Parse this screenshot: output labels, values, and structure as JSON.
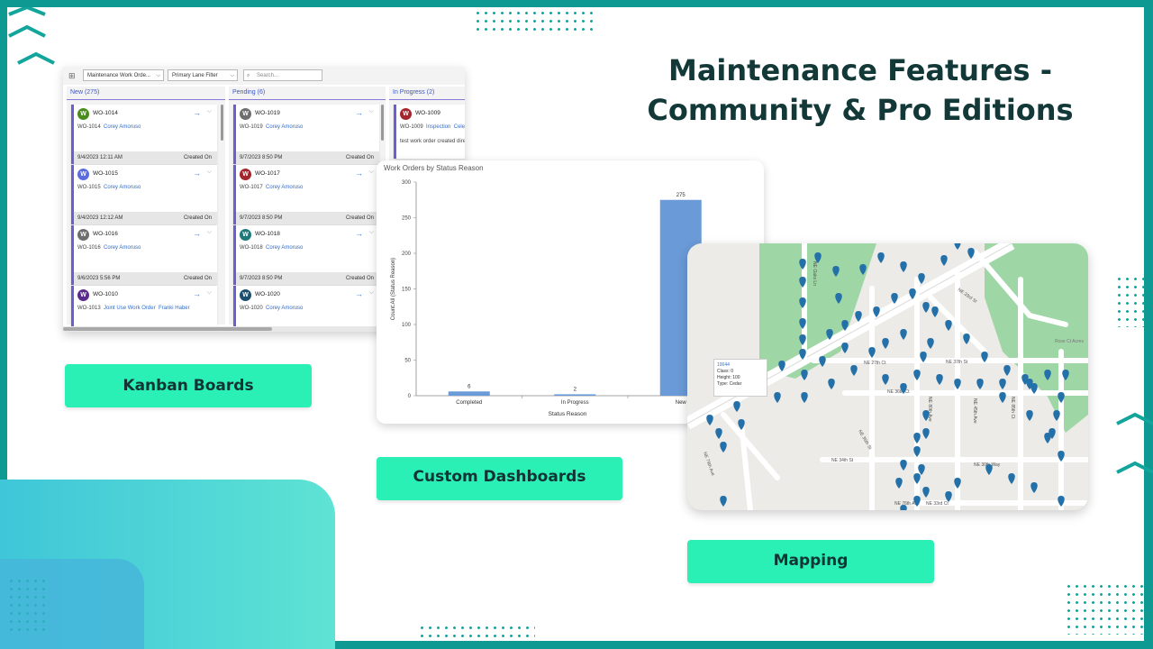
{
  "title": "Maintenance Features - Community & Pro Editions",
  "labels": {
    "kanban": "Kanban Boards",
    "dashboards": "Custom Dashboards",
    "mapping": "Mapping"
  },
  "colors": {
    "frame": "#0e9a93",
    "label_bg": "#2af0b6",
    "bar": "#6a9bd8",
    "park": "#9fd6a6",
    "pin": "#2470a8"
  },
  "kanban": {
    "toolbar": {
      "view_select": "Maintenance Work Orde...",
      "lane_filter": "Primary Lane Filter",
      "search_placeholder": "Search..."
    },
    "columns": [
      {
        "header": "New (275)",
        "cards": [
          {
            "avatar": "W",
            "avatar_color": "#4a8c1c",
            "title": "WO-1014",
            "sub": "WO-1014",
            "person": "Corey Amoruso",
            "date": "9/4/2023 12:11 AM",
            "foot": "Created On"
          },
          {
            "avatar": "W",
            "avatar_color": "#5b6be0",
            "title": "WO-1015",
            "sub": "WO-1015",
            "person": "Corey Amoruso",
            "date": "9/4/2023 12:12 AM",
            "foot": "Created On"
          },
          {
            "avatar": "W",
            "avatar_color": "#6e6e6e",
            "title": "WO-1016",
            "sub": "WO-1016",
            "person": "Corey Amoruso",
            "date": "9/6/2023 5:56 PM",
            "foot": "Created On"
          },
          {
            "avatar": "W",
            "avatar_color": "#5a2a8c",
            "title": "WO-1010",
            "sub": "WO-1013",
            "person": "Joint Use Work Order",
            "person2": "Franki Haber",
            "date": "",
            "foot": ""
          }
        ]
      },
      {
        "header": "Pending (6)",
        "cards": [
          {
            "avatar": "W",
            "avatar_color": "#6e6e6e",
            "title": "WO-1019",
            "sub": "WO-1019",
            "person": "Corey Amoruso",
            "date": "9/7/2023 8:50 PM",
            "foot": "Created On"
          },
          {
            "avatar": "W",
            "avatar_color": "#a4262c",
            "title": "WO-1017",
            "sub": "WO-1017",
            "person": "Corey Amoruso",
            "date": "9/7/2023 8:50 PM",
            "foot": "Created On"
          },
          {
            "avatar": "W",
            "avatar_color": "#1e7a7a",
            "title": "WO-1018",
            "sub": "WO-1018",
            "person": "Corey Amoruso",
            "date": "9/7/2023 8:50 PM",
            "foot": "Created On"
          },
          {
            "avatar": "W",
            "avatar_color": "#1b4f6e",
            "title": "WO-1020",
            "sub": "WO-1020",
            "person": "Corey Amoruso",
            "date": "",
            "foot": ""
          }
        ]
      },
      {
        "header": "In Progress (2)",
        "cards": [
          {
            "avatar": "W",
            "avatar_color": "#a4262c",
            "title": "WO-1009",
            "sub": "WO-1009",
            "person": "Inspection",
            "person2": "Cele",
            "note": "test work order created dire",
            "date": "",
            "foot": ""
          }
        ]
      }
    ]
  },
  "chart_data": {
    "type": "bar",
    "title": "Work Orders by Status Reason",
    "xlabel": "Status Reason",
    "ylabel": "Count:All (Status Reason)",
    "categories": [
      "Completed",
      "In Progress",
      "New"
    ],
    "values": [
      6,
      2,
      275
    ],
    "ylim": [
      0,
      300
    ],
    "yticks": [
      0,
      50,
      100,
      150,
      200,
      250,
      300
    ],
    "data_labels": [
      "6",
      "2",
      "275"
    ],
    "grid": false
  },
  "map": {
    "tooltip": {
      "id": "10044",
      "class": "Class: 0",
      "height": "Height: 100",
      "type": "Type: Cedar"
    },
    "streets": [
      "NE 27th Ct",
      "NE 37th St",
      "NE 36th Ct",
      "NE 34th St",
      "NE 30th Way",
      "NE 33rd Ct",
      "NE 33rd St",
      "NE 35th St",
      "NE 45th Ave",
      "NE 80th Ave",
      "NE 85th Ct",
      "NE 79th Ave",
      "NE Oaks Ln",
      "NE 76th Ave",
      "NE Pacific Way"
    ],
    "poi": "Rose Ct Acres"
  }
}
